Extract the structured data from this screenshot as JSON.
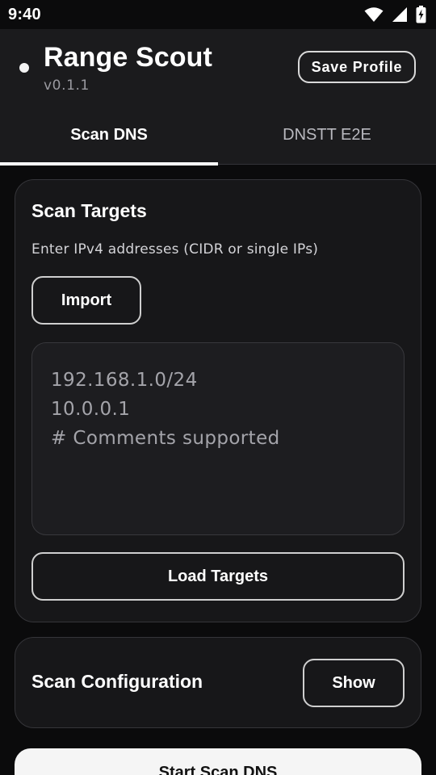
{
  "status_bar": {
    "time": "9:40",
    "icons": [
      "wifi-icon",
      "cell-signal-icon",
      "battery-charging-icon"
    ]
  },
  "header": {
    "title": "Range Scout",
    "version": "v0.1.1",
    "save_profile_label": "Save Profile",
    "status_dot_color": "#f4f4f4"
  },
  "tabs": [
    {
      "label": "Scan DNS",
      "active": true
    },
    {
      "label": "DNSTT E2E",
      "active": false
    }
  ],
  "scan_targets": {
    "title": "Scan Targets",
    "subtitle": "Enter IPv4 addresses (CIDR or single IPs)",
    "import_label": "Import",
    "textarea_lines": [
      "192.168.1.0/24",
      "10.0.0.1",
      "# Comments supported"
    ],
    "load_label": "Load Targets"
  },
  "scan_configuration": {
    "title": "Scan Configuration",
    "show_label": "Show"
  },
  "primary_action": {
    "label": "Start Scan DNS"
  },
  "colors": {
    "background": "#0b0b0c",
    "surface": "#1b1b1d",
    "card": "#171719",
    "accent": "#ffffff"
  }
}
